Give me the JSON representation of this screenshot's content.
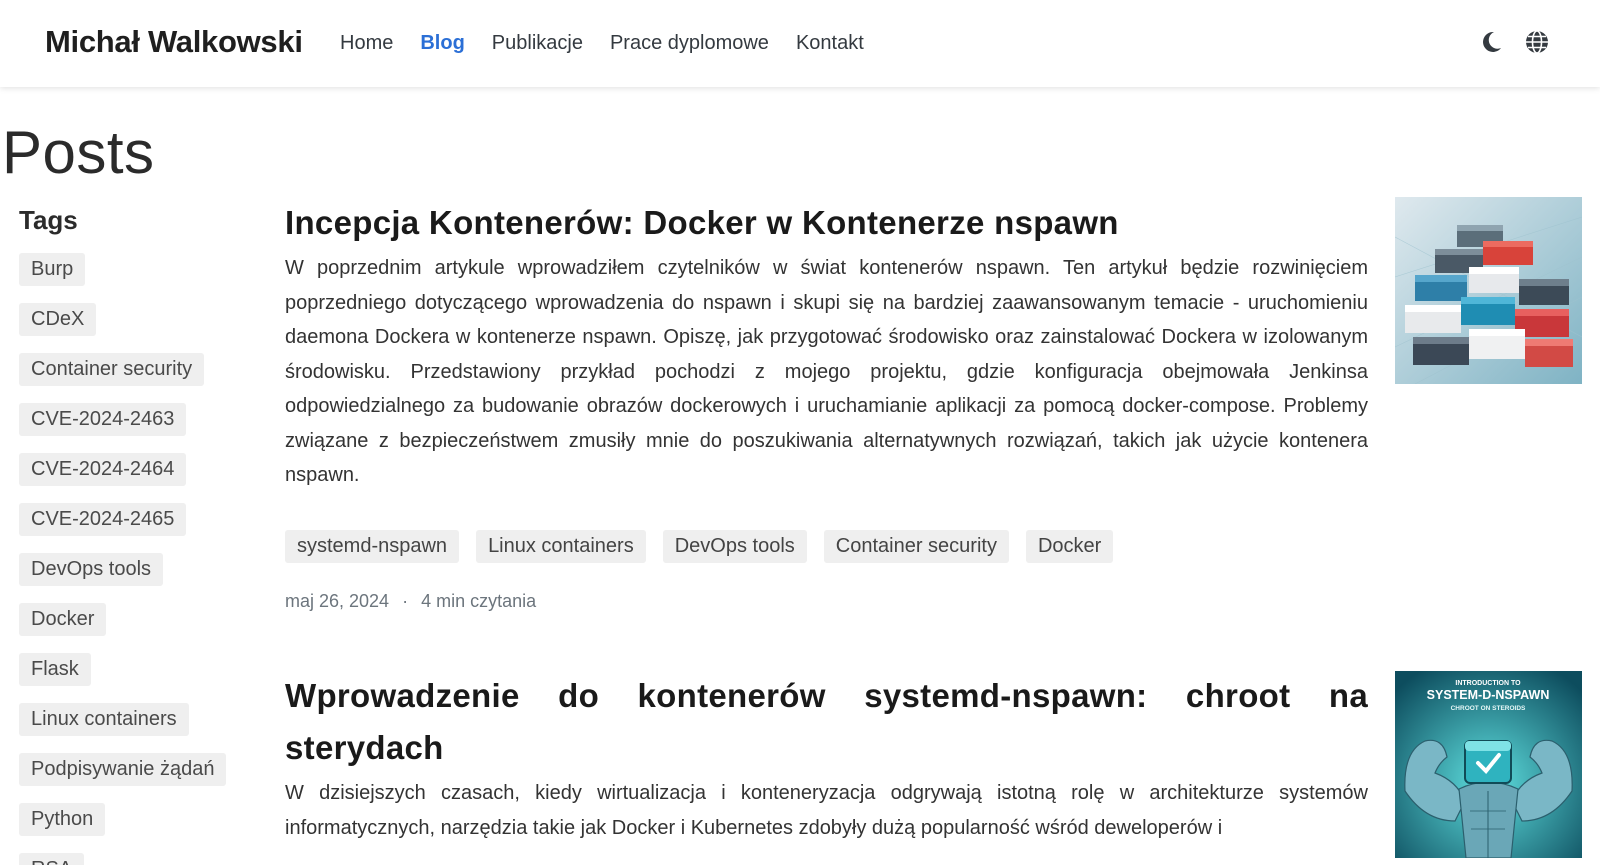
{
  "header": {
    "brand": "Michał Walkowski",
    "nav": [
      "Home",
      "Blog",
      "Publikacje",
      "Prace dyplomowe",
      "Kontakt"
    ],
    "active_nav": "Blog",
    "icons": [
      "moon-icon",
      "globe-icon"
    ]
  },
  "page": {
    "title": "Posts"
  },
  "sidebar": {
    "heading": "Tags",
    "tags": [
      "Burp",
      "CDeX",
      "Container security",
      "CVE-2024-2463",
      "CVE-2024-2464",
      "CVE-2024-2465",
      "DevOps tools",
      "Docker",
      "Flask",
      "Linux containers",
      "Podpisywanie żądań",
      "Python",
      "RSA"
    ]
  },
  "posts": [
    {
      "title": "Incepcja Kontenerów: Docker w Kontenerze nspawn",
      "excerpt": "W poprzednim artykule wprowadziłem czytelników w świat kontenerów nspawn. Ten artykuł będzie rozwinięciem poprzedniego dotyczącego wprowadzenia do nspawn i skupi się na bardziej zaawansowanym temacie - uruchomieniu daemona Dockera w kontenerze nspawn. Opiszę, jak przygotować środowisko oraz zainstalować Dockera w izolowanym środowisku. Przedstawiony przykład pochodzi z mojego projektu, gdzie konfiguracja obejmowała Jenkinsa odpowiedzialnego za budowanie obrazów dockerowych i uruchamianie aplikacji za pomocą docker-compose. Problemy związane z bezpieczeństwem zmusiły mnie do poszukiwania alternatywnych rozwiązań, takich jak użycie kontenera nspawn.",
      "tags": [
        "systemd-nspawn",
        "Linux containers",
        "DevOps tools",
        "Container security",
        "Docker"
      ],
      "date": "maj 26, 2024",
      "meta_separator": "·",
      "reading_time": "4 min czytania"
    },
    {
      "title": "Wprowadzenie do kontenerów systemd-nspawn: chroot na sterydach",
      "excerpt": "W dzisiejszych czasach, kiedy wirtualizacja i konteneryzacja odgrywają istotną rolę w architekturze systemów informatycznych, narzędzia takie jak Docker i Kubernetes zdobyły dużą popularność wśród deweloperów i",
      "thumb_text": [
        "INTRODUCTION TO",
        "SYSTEM-D-NSPAWN",
        "CHROOT ON STEROIDS"
      ]
    }
  ],
  "colors": {
    "accent": "#2b6fd6",
    "tag_bg": "#efefef",
    "text": "#333333",
    "meta": "#6c757d"
  }
}
